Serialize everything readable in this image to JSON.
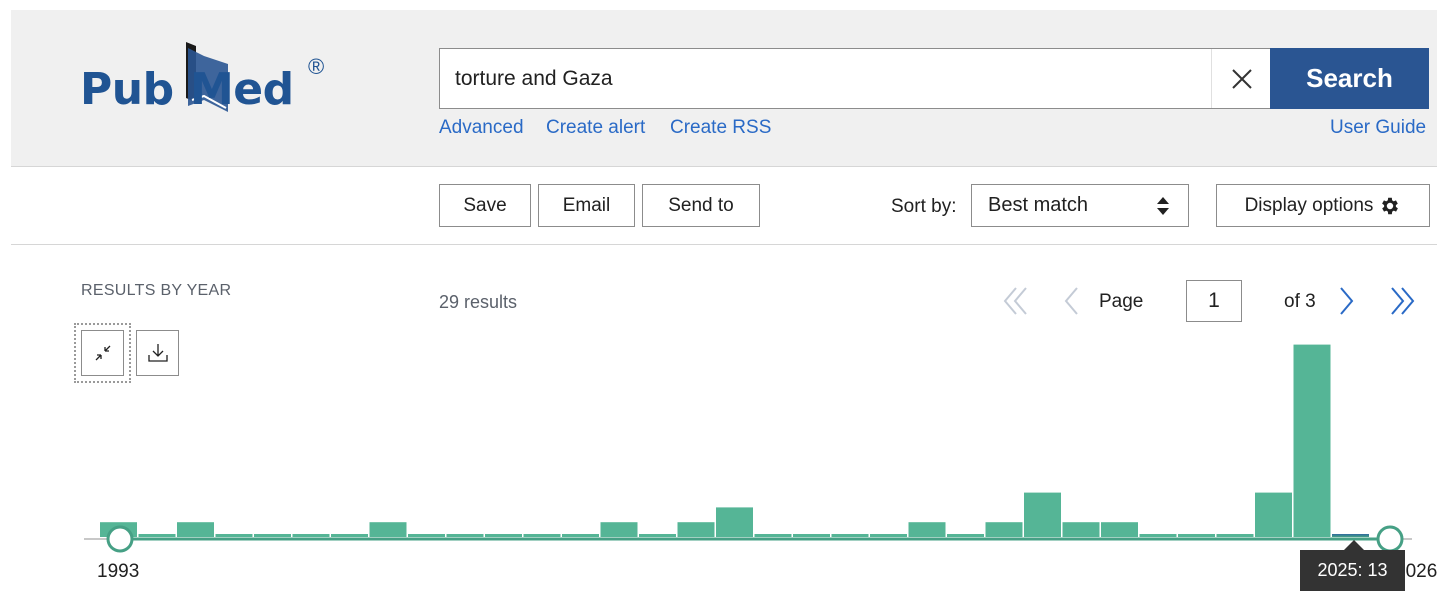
{
  "header": {
    "logo": {
      "part1": "Pub",
      "part2": "Med",
      "reg": "®"
    },
    "search": {
      "value": "torture and Gaza",
      "clear_icon": "close-icon",
      "button_label": "Search"
    },
    "links": {
      "advanced": "Advanced",
      "create_alert": "Create alert",
      "create_rss": "Create RSS",
      "user_guide": "User Guide"
    }
  },
  "toolbar": {
    "save_label": "Save",
    "email_label": "Email",
    "send_to_label": "Send to",
    "sort_label": "Sort by:",
    "sort_value": "Best match",
    "display_options_label": "Display options",
    "display_icon": "gear-icon"
  },
  "results_by_year": {
    "heading": "RESULTS BY YEAR",
    "collapse_icon": "collapse-icon",
    "download_icon": "download-icon",
    "range_start_label": "1993",
    "range_end_label": "2026",
    "tooltip": "2025: 13"
  },
  "results": {
    "count_text": "29 results"
  },
  "pagination": {
    "page_label": "Page",
    "current_page": "1",
    "of_label": "of 3"
  },
  "chart_data": {
    "type": "bar",
    "categories": [
      "1993",
      "1994",
      "1995",
      "1996",
      "1997",
      "1998",
      "1999",
      "2000",
      "2001",
      "2002",
      "2003",
      "2004",
      "2005",
      "2006",
      "2007",
      "2008",
      "2009",
      "2010",
      "2011",
      "2012",
      "2013",
      "2014",
      "2015",
      "2016",
      "2017",
      "2018",
      "2019",
      "2020",
      "2021",
      "2022",
      "2023",
      "2024",
      "2025"
    ],
    "values": [
      1,
      0,
      1,
      0,
      0,
      0,
      0,
      1,
      0,
      0,
      0,
      0,
      0,
      1,
      0,
      1,
      2,
      0,
      0,
      0,
      0,
      1,
      0,
      1,
      3,
      1,
      1,
      0,
      0,
      0,
      3,
      13,
      0
    ],
    "selected": {
      "label": "2025",
      "value": 13
    },
    "colors": {
      "bar": "#55b596",
      "highlight_top": "#2f6a9e",
      "highlight_bottom": "#46a085",
      "axis": "#46a085"
    }
  }
}
